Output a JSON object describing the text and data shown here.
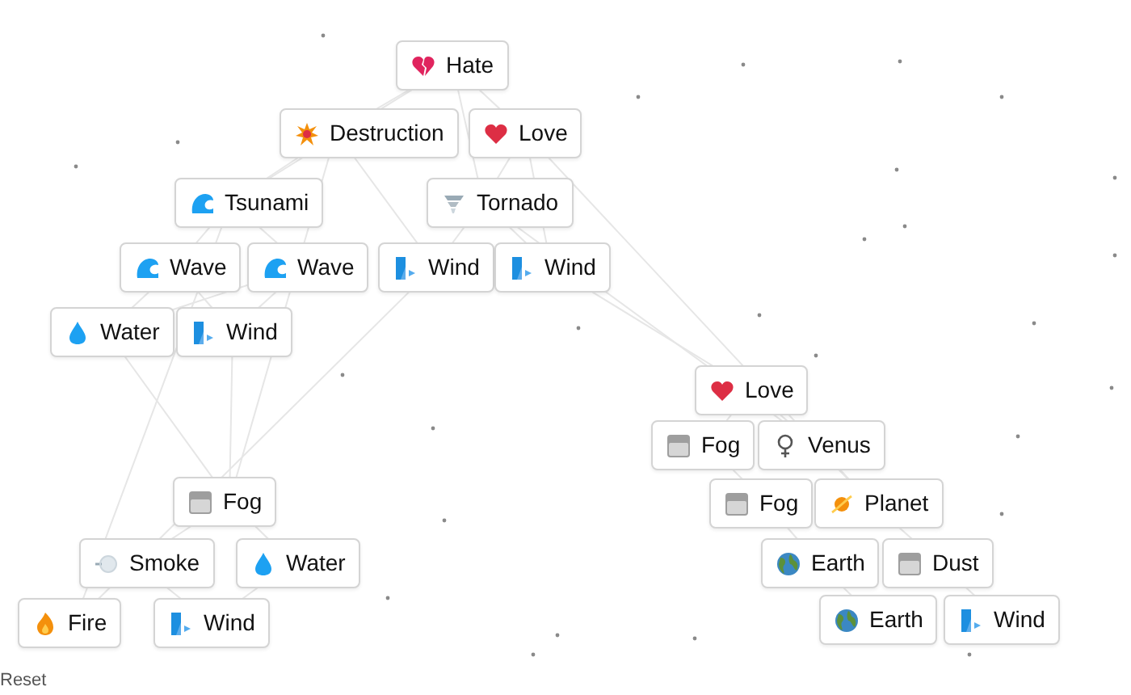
{
  "elements": [
    {
      "label": "Hate",
      "kind": "broken-heart"
    },
    {
      "label": "Destruction",
      "kind": "burst"
    },
    {
      "label": "Love",
      "kind": "heart"
    },
    {
      "label": "Tsunami",
      "kind": "wave"
    },
    {
      "label": "Tornado",
      "kind": "tornado"
    },
    {
      "label": "Wave",
      "kind": "wave"
    },
    {
      "label": "Wave",
      "kind": "wave"
    },
    {
      "label": "Wind",
      "kind": "wind"
    },
    {
      "label": "Wind",
      "kind": "wind"
    },
    {
      "label": "Water",
      "kind": "droplet"
    },
    {
      "label": "Wind",
      "kind": "wind"
    },
    {
      "label": "Fog",
      "kind": "fog"
    },
    {
      "label": "Smoke",
      "kind": "smoke"
    },
    {
      "label": "Water",
      "kind": "droplet"
    },
    {
      "label": "Fire",
      "kind": "fire"
    },
    {
      "label": "Wind",
      "kind": "wind"
    },
    {
      "label": "Love",
      "kind": "heart"
    },
    {
      "label": "Fog",
      "kind": "fog"
    },
    {
      "label": "Venus",
      "kind": "venus"
    },
    {
      "label": "Fog",
      "kind": "fog"
    },
    {
      "label": "Planet",
      "kind": "planet"
    },
    {
      "label": "Earth",
      "kind": "globe"
    },
    {
      "label": "Dust",
      "kind": "fog"
    },
    {
      "label": "Earth",
      "kind": "globe"
    },
    {
      "label": "Wind",
      "kind": "wind"
    }
  ],
  "reset": "Reset"
}
